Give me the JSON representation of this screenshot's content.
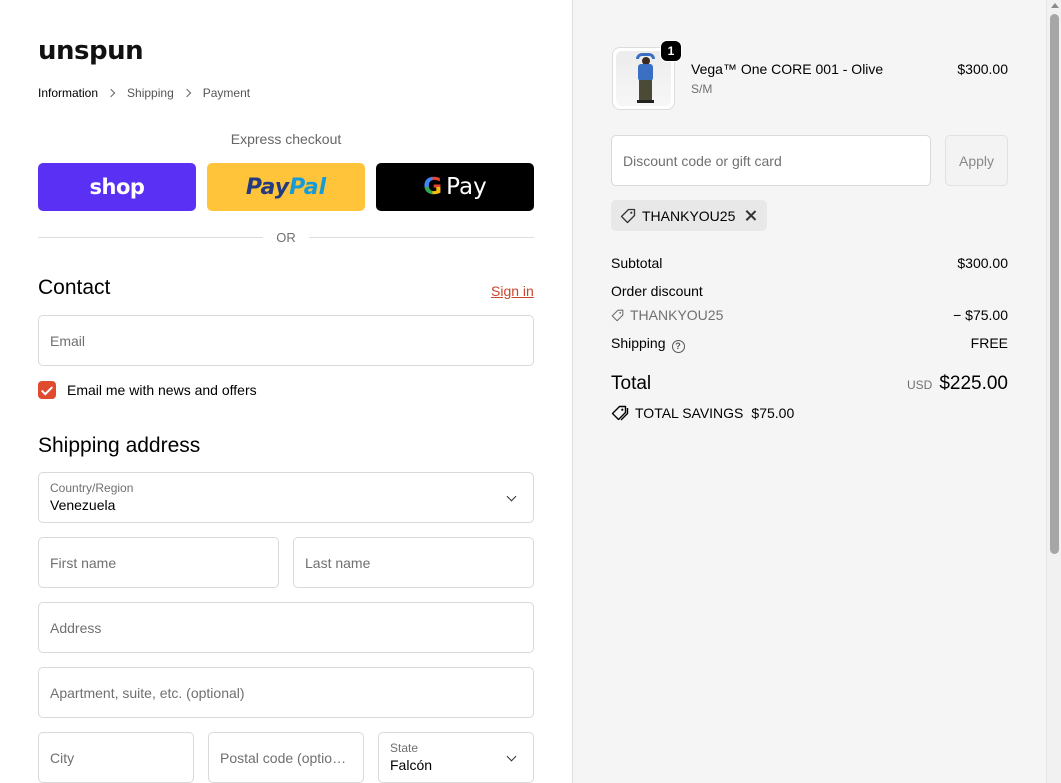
{
  "brand": {
    "logo": "unspun"
  },
  "breadcrumb": [
    "Information",
    "Shipping",
    "Payment"
  ],
  "express": {
    "title": "Express checkout",
    "shop_label": "shop",
    "paypal_pay": "Pay",
    "paypal_pal": "Pal",
    "gpay_g": "G",
    "gpay_label": "Pay",
    "or_label": "OR"
  },
  "contact": {
    "title": "Contact",
    "signin": "Sign in",
    "email_placeholder": "Email",
    "newsletter_label": "Email me with news and offers",
    "newsletter_checked": true
  },
  "shipping": {
    "title": "Shipping address",
    "country_label": "Country/Region",
    "country_value": "Venezuela",
    "first_name": "First name",
    "last_name": "Last name",
    "address": "Address",
    "apartment": "Apartment, suite, etc. (optional)",
    "city": "City",
    "postal": "Postal code (optional)",
    "state_label": "State",
    "state_value": "Falcón"
  },
  "cart": {
    "item": {
      "name": "Vega™ One CORE 001 - Olive",
      "variant": "S/M",
      "price": "$300.00",
      "quantity": "1"
    },
    "discount_placeholder": "Discount code or gift card",
    "apply_label": "Apply",
    "applied_code": "THANKYOU25"
  },
  "summary": {
    "subtotal_label": "Subtotal",
    "subtotal_value": "$300.00",
    "order_discount_label": "Order discount",
    "discount_code": "THANKYOU25",
    "discount_value": "− $75.00",
    "shipping_label": "Shipping",
    "shipping_value": "FREE",
    "total_label": "Total",
    "currency": "USD",
    "total_value": "$225.00",
    "savings_label": "TOTAL SAVINGS",
    "savings_value": "$75.00"
  },
  "colors": {
    "shop": "#5a31f4",
    "paypal": "#ffc439",
    "accent": "#e04a2f",
    "right_panel_bg": "#f5f5f5"
  }
}
